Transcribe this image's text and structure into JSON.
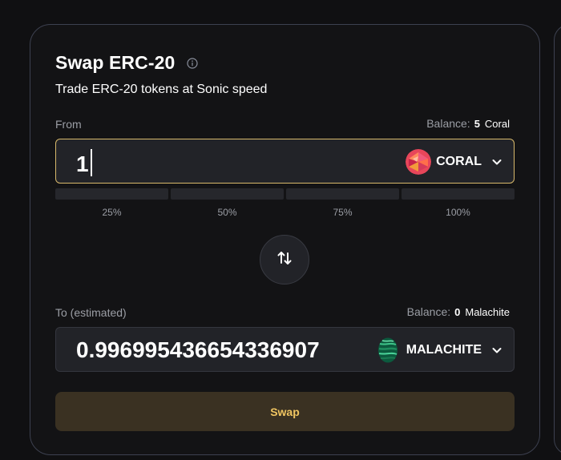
{
  "header": {
    "title": "Swap ERC-20",
    "info_icon": "info-icon",
    "subtitle": "Trade ERC-20 tokens at Sonic speed"
  },
  "from": {
    "label": "From",
    "balance_label": "Balance:",
    "balance_value": "5",
    "balance_symbol": "Coral",
    "amount": "1",
    "token": "CORAL",
    "token_icon": "coral-token-icon"
  },
  "percentages": [
    "25%",
    "50%",
    "75%",
    "100%"
  ],
  "direction_icon": "swap-direction-icon",
  "to": {
    "label": "To (estimated)",
    "balance_label": "Balance:",
    "balance_value": "0",
    "balance_symbol": "Malachite",
    "amount": "0.996995436654336907",
    "token": "MALACHITE",
    "token_icon": "malachite-token-icon"
  },
  "actions": {
    "swap_label": "Swap"
  },
  "colors": {
    "background": "#101012",
    "card_border": "#3d4150",
    "input_focus_border": "#d8b96b",
    "swap_button_bg": "#3a3122",
    "swap_button_text": "#f0c561"
  }
}
